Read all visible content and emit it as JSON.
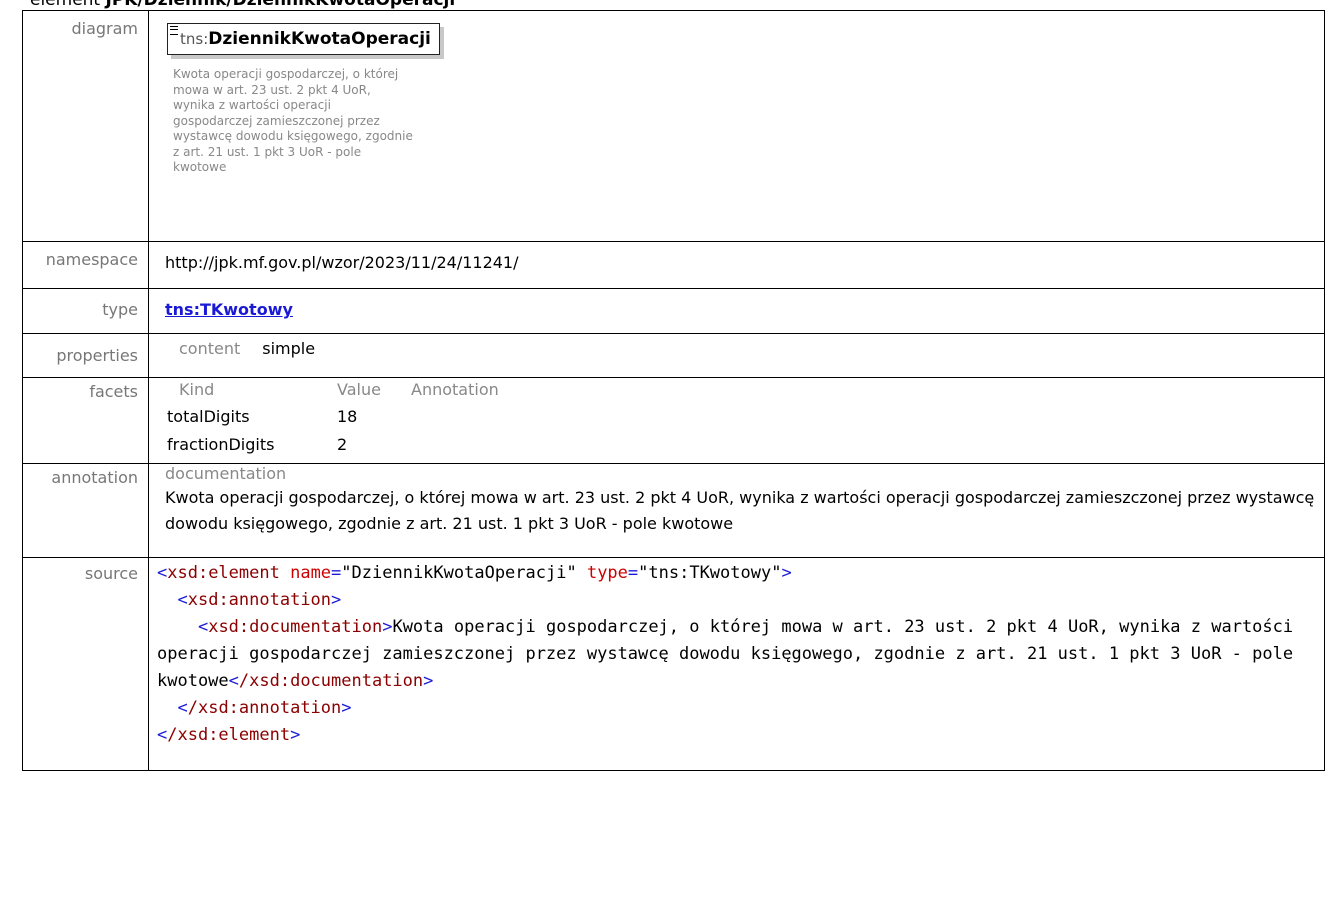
{
  "heading": {
    "prefix": "element ",
    "path": "JPK/Dziennik/DziennikKwotaOperacji"
  },
  "rows": {
    "diagram": {
      "label": "diagram",
      "prefix": "tns:",
      "name": "DziennikKwotaOperacji",
      "doc": "Kwota operacji gospodarczej, o której mowa w art. 23 ust. 2 pkt 4 UoR, wynika z wartości operacji gospodarczej zamieszczonej przez wystawcę dowodu księgowego, zgodnie z art. 21 ust. 1 pkt 3 UoR - pole kwotowe"
    },
    "namespace": {
      "label": "namespace",
      "value": "http://jpk.mf.gov.pl/wzor/2023/11/24/11241/"
    },
    "type": {
      "label": "type",
      "value": "tns:TKwotowy"
    },
    "properties": {
      "label": "properties",
      "key": "content",
      "value": "simple"
    },
    "facets": {
      "label": "facets",
      "headers": [
        "Kind",
        "Value",
        "Annotation"
      ],
      "items": [
        {
          "kind": "totalDigits",
          "value": "18"
        },
        {
          "kind": "fractionDigits",
          "value": "2"
        }
      ]
    },
    "annotation": {
      "label": "annotation",
      "header": "documentation",
      "text": "Kwota operacji gospodarczej, o której mowa w art. 23 ust. 2 pkt 4 UoR, wynika z wartości operacji gospodarczej zamieszczonej przez wystawcę dowodu księgowego, zgodnie z art. 21 ust. 1 pkt 3 UoR - pole kwotowe"
    },
    "source": {
      "label": "source",
      "open_element": "xsd:element",
      "attr_name": "name",
      "attr_name_value": "\"DziennikKwotaOperacji\"",
      "attr_type": "type",
      "attr_type_value": "\"tns:TKwotowy\"",
      "annotation_tag": "xsd:annotation",
      "documentation_tag": "xsd:documentation",
      "documentation_text": "Kwota operacji gospodarczej, o której mowa w art. 23 ust. 2 pkt 4 UoR, wynika z wartości operacji gospodarczej zamieszczonej przez wystawcę dowodu księgowego, zgodnie z art. 21 ust. 1 pkt 3 UoR - pole kwotowe",
      "close_documentation": "/xsd:documentation",
      "close_annotation": "/xsd:annotation",
      "close_element": "/xsd:element"
    }
  }
}
